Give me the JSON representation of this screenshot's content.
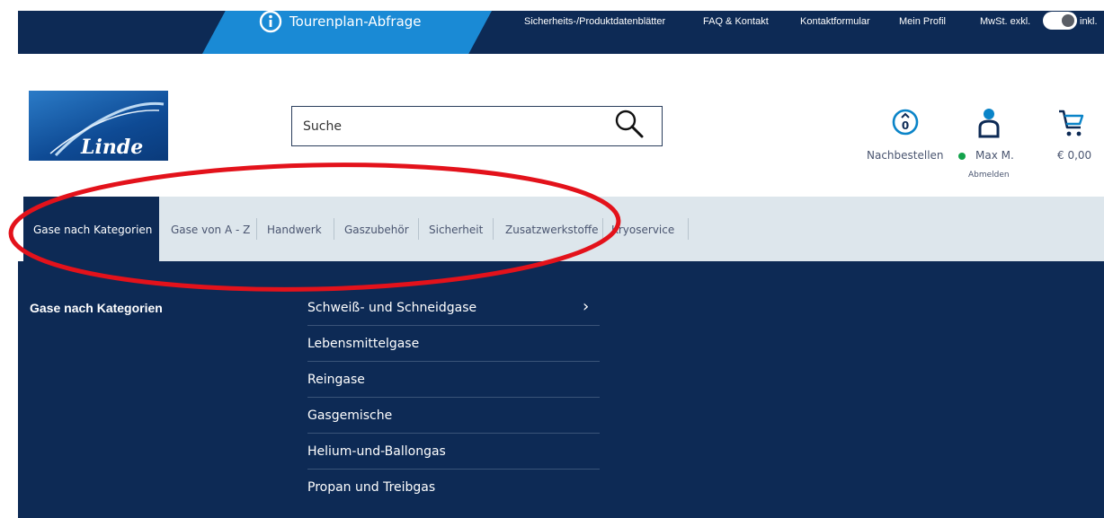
{
  "topbar": {
    "tour_label": "Tourenplan-Abfrage",
    "links": [
      {
        "label": "Sicherheits-/Produktdatenblätter"
      },
      {
        "label": "FAQ & Kontakt"
      },
      {
        "label": "Kontaktformular"
      },
      {
        "label": "Mein Profil"
      }
    ],
    "vat_excl": "MwSt. exkl.",
    "vat_incl": "inkl."
  },
  "header": {
    "logo_text": "Linde",
    "search_placeholder": "Suche",
    "reorder_label": "Nachbestellen",
    "user_name": "Max M.",
    "logout_label": "Abmelden",
    "cart_total": "€ 0,00"
  },
  "nav": {
    "tabs": [
      {
        "label": "Gase nach Kategorien",
        "active": true
      },
      {
        "label": "Gase von A - Z"
      },
      {
        "label": "Handwerk"
      },
      {
        "label": "Gaszubehör"
      },
      {
        "label": "Sicherheit"
      },
      {
        "label": "Zusatzwerkstoffe"
      },
      {
        "label": "Kryoservice"
      }
    ]
  },
  "mega_menu": {
    "title": "Gase nach Kategorien",
    "items": [
      {
        "label": "Schweiß- und Schneidgase"
      },
      {
        "label": "Lebensmittelgase"
      },
      {
        "label": "Reingase"
      },
      {
        "label": "Gasgemische"
      },
      {
        "label": "Helium-und-Ballongas"
      },
      {
        "label": "Propan und Treibgas"
      }
    ]
  },
  "colors": {
    "navy": "#0d2a55",
    "accent_blue": "#1a8ad5",
    "nav_bg": "#dde6ec",
    "annotation_red": "#e3121b",
    "status_green": "#13a24b"
  },
  "icons": {
    "tour": "info-circle-icon",
    "search": "magnifier-icon",
    "reorder": "reorder-icon",
    "user": "user-icon",
    "cart": "cart-icon",
    "chevron": "chevron-right-icon"
  }
}
